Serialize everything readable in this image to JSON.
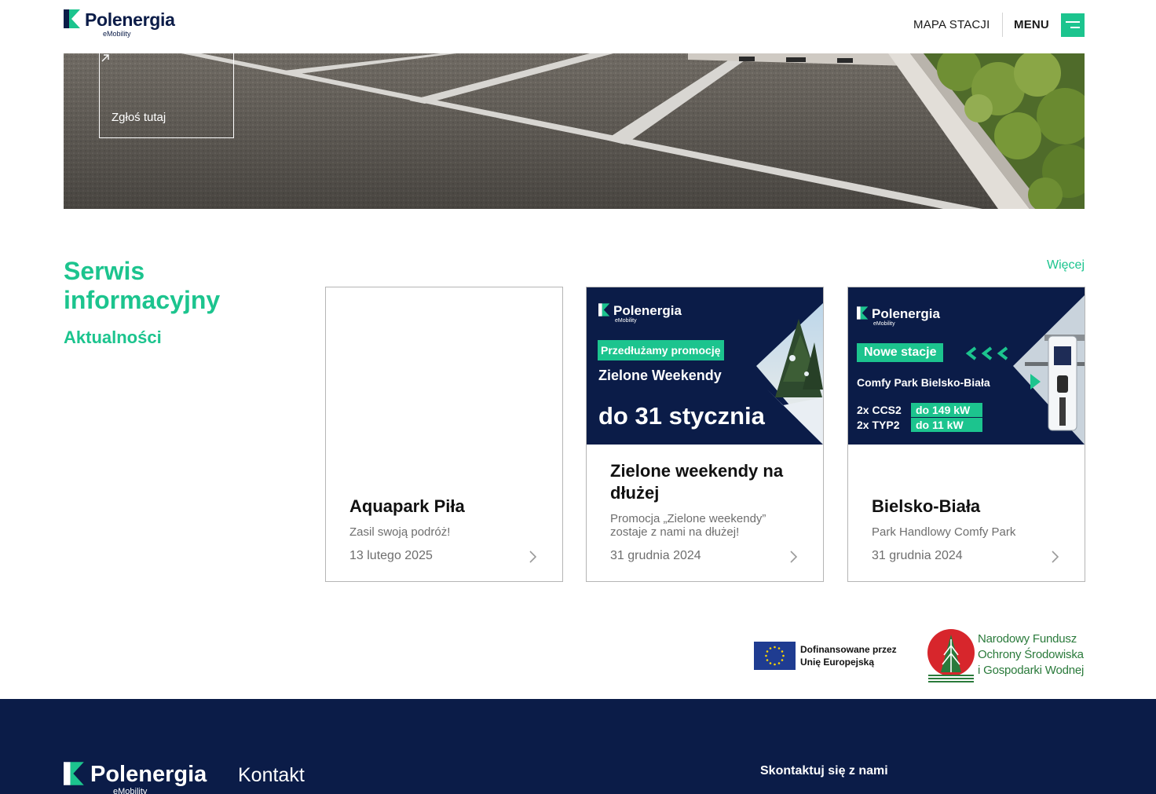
{
  "header": {
    "logo_name": "Polenergia",
    "logo_sub": "eMobility",
    "map_label": "MAPA STACJI",
    "menu_label": "MENU"
  },
  "hero": {
    "report_label": "Zgłoś tutaj"
  },
  "info": {
    "title": "Serwis informacyjny",
    "subtitle": "Aktualności",
    "more_label": "Więcej",
    "cards": [
      {
        "title": "Aquapark Piła",
        "desc": "Zasil swoją podróż!",
        "date": "13 lutego 2025"
      },
      {
        "title": "Zielone weekendy na dłużej",
        "desc": "Promocja „Zielone weekendy” zostaje z nami na dłużej!",
        "date": "31 grudnia 2024",
        "banner": {
          "logo_name": "Polenergia",
          "logo_sub": "eMobility",
          "tag": "Przedłużamy promocję",
          "line1": "Zielone Weekendy",
          "line2": "do 31 stycznia"
        }
      },
      {
        "title": "Bielsko-Biała",
        "desc": "Park Handlowy Comfy Park",
        "date": "31 grudnia 2024",
        "banner": {
          "logo_name": "Polenergia",
          "logo_sub": "eMobility",
          "tag": "Nowe stacje",
          "line1": "Comfy Park Bielsko-Biała",
          "spec1_label": "2x CCS2",
          "spec1_value": "do 149 kW",
          "spec2_label": "2x TYP2",
          "spec2_value": "do 11 kW"
        }
      }
    ]
  },
  "funding": {
    "eu_line1": "Dofinansowane przez",
    "eu_line2": "Unię Europejską",
    "nf_line1": "Narodowy Fundusz",
    "nf_line2": "Ochrony Środowiska",
    "nf_line3": "i Gospodarki Wodnej"
  },
  "footer": {
    "logo_name": "Polenergia",
    "logo_sub": "eMobility",
    "contact_heading": "Kontakt",
    "reach_heading": "Skontaktuj się z nami"
  },
  "colors": {
    "accent": "#1cc48e",
    "navy": "#0b1c48"
  }
}
